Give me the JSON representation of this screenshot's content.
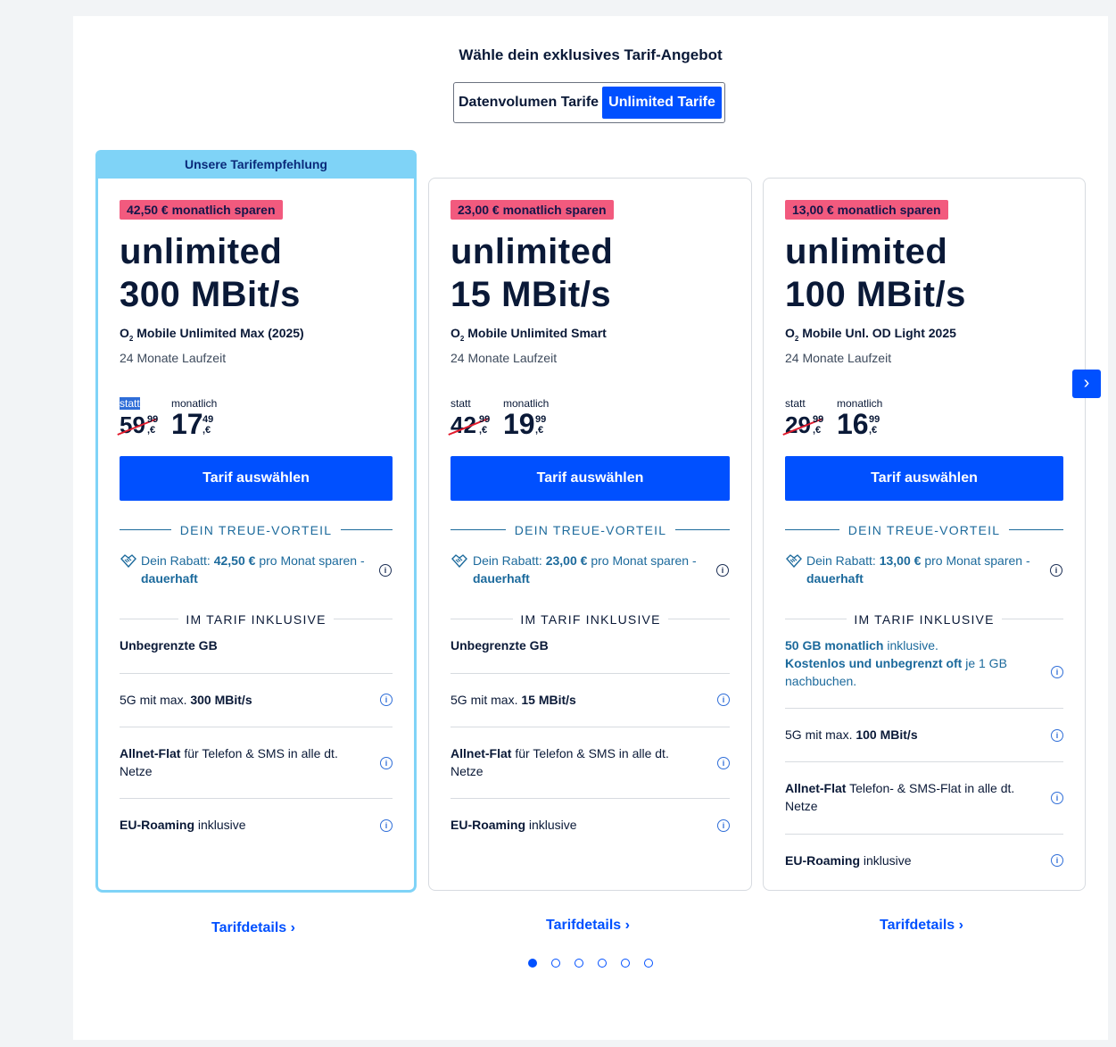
{
  "page": {
    "heading": "Wähle dein exklusives Tarif-Angebot",
    "toggle": {
      "option_a": "Datenvolumen Tarife",
      "option_b": "Unlimited Tarife",
      "selected": "Unlimited Tarife"
    },
    "recommendation_banner": "Unsere Tarifempfehlung",
    "colors": {
      "accent": "#0050ff",
      "save_badge": "#f25a7e",
      "recommend": "#7fd3f7",
      "treue_text": "#1c6a9c"
    }
  },
  "cards": [
    {
      "save": "42,50 € monatlich sparen",
      "speed_line1": "unlimited",
      "speed_line2": "300 MBit/s",
      "name_o": "O",
      "name_sub": "2",
      "name": " Mobile Unlimited Max (2025)",
      "term": "24 Monate Laufzeit",
      "statt_label": "statt",
      "monthly_label": "monatlich",
      "old_euro": "59",
      "old_cents": "99",
      "price_euro": "17",
      "price_cents": "49",
      "currency": ",€",
      "button": "Tarif auswählen",
      "treue_title": "DEIN TREUE-VORTEIL",
      "rabatt_prefix": "Dein Rabatt: ",
      "rabatt_amount": "42,50 €",
      "rabatt_suffix": " pro Monat sparen -",
      "rabatt_dauer": "dauerhaft",
      "inkl_title": "IM TARIF INKLUSIVE",
      "feature_gb": "Unbegrenzte GB",
      "feature_5g_a": "5G mit max. ",
      "feature_5g_b": "300 MBit/s",
      "feature_allnet_a": "Allnet-Flat",
      "feature_allnet_b": " für Telefon & SMS in alle dt. Netze",
      "feature_roam_a": "EU-Roaming",
      "feature_roam_b": " inklusive",
      "details": "Tarifdetails"
    },
    {
      "save": "23,00 € monatlich sparen",
      "speed_line1": "unlimited",
      "speed_line2": "15 MBit/s",
      "name_o": "O",
      "name_sub": "2",
      "name": " Mobile Unlimited Smart",
      "term": "24 Monate Laufzeit",
      "statt_label": "statt",
      "monthly_label": "monatlich",
      "old_euro": "42",
      "old_cents": "99",
      "price_euro": "19",
      "price_cents": "99",
      "currency": ",€",
      "button": "Tarif auswählen",
      "treue_title": "DEIN TREUE-VORTEIL",
      "rabatt_prefix": "Dein Rabatt: ",
      "rabatt_amount": "23,00 €",
      "rabatt_suffix": " pro Monat sparen -",
      "rabatt_dauer": "dauerhaft",
      "inkl_title": "IM TARIF INKLUSIVE",
      "feature_gb": "Unbegrenzte GB",
      "feature_5g_a": "5G mit max. ",
      "feature_5g_b": "15 MBit/s",
      "feature_allnet_a": "Allnet-Flat",
      "feature_allnet_b": " für Telefon & SMS in alle dt. Netze",
      "feature_roam_a": "EU-Roaming",
      "feature_roam_b": " inklusive",
      "details": "Tarifdetails"
    },
    {
      "save": "13,00 € monatlich sparen",
      "speed_line1": "unlimited",
      "speed_line2": "100 MBit/s",
      "name_o": "O",
      "name_sub": "2",
      "name": " Mobile Unl. OD Light 2025",
      "term": "24 Monate Laufzeit",
      "statt_label": "statt",
      "monthly_label": "monatlich",
      "old_euro": "29",
      "old_cents": "99",
      "price_euro": "16",
      "price_cents": "99",
      "currency": ",€",
      "button": "Tarif auswählen",
      "treue_title": "DEIN TREUE-VORTEIL",
      "rabatt_prefix": "Dein Rabatt: ",
      "rabatt_amount": "13,00 €",
      "rabatt_suffix": " pro Monat sparen -",
      "rabatt_dauer": "dauerhaft",
      "inkl_title": "IM TARIF INKLUSIVE",
      "feature_gb_a": "50 GB monatlich",
      "feature_gb_b": " inklusive.",
      "feature_gb_c": "Kostenlos und unbegrenzt oft",
      "feature_gb_d": " je 1 GB nachbuchen.",
      "feature_5g_a": "5G mit max. ",
      "feature_5g_b": "100 MBit/s",
      "feature_allnet_a": "Allnet-Flat",
      "feature_allnet_b": " Telefon- & SMS-Flat in alle dt. Netze",
      "feature_roam_a": "EU-Roaming",
      "feature_roam_b": " inklusive",
      "details": "Tarifdetails"
    }
  ],
  "carousel": {
    "next_icon": "chevron-right-icon",
    "dots_total": 6,
    "dot_active": 1
  }
}
